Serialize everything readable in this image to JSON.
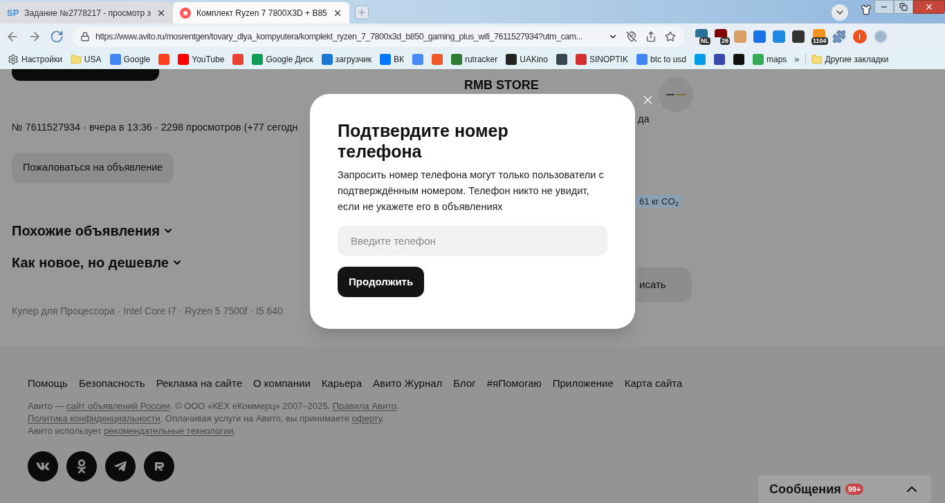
{
  "browser": {
    "tabs": [
      {
        "favicon_text": "SP",
        "title": "Задание №2778217 - просмотр з",
        "selected": false
      },
      {
        "title": "Комплект Ryzen 7 7800X3D + B85",
        "selected": true
      }
    ],
    "url": "https://www.avito.ru/mosrentgen/tovary_dlya_kompyutera/komplekt_ryzen_7_7800x3d_b850_gaming_plus_wifi_7611527934?utm_cam...",
    "extensions": [
      {
        "color": "#2a6f97",
        "badge": "NL"
      },
      {
        "color": "#800000",
        "badge": "26"
      },
      {
        "color": "#d9a066"
      },
      {
        "color": "#1a73e8"
      },
      {
        "color": "#1e88e5"
      },
      {
        "color": "#333333"
      },
      {
        "color": "#f7931a",
        "badge": "1104"
      }
    ],
    "profile_initial": "I",
    "bookmarks": [
      {
        "kind": "gear",
        "label": "Настройки"
      },
      {
        "kind": "folder",
        "label": "USA"
      },
      {
        "kind": "favicon",
        "color": "#4285f4",
        "label": "Google"
      },
      {
        "kind": "favicon",
        "color": "#fc3f1d"
      },
      {
        "kind": "favicon",
        "color": "#ff0000",
        "label": "YouTube"
      },
      {
        "kind": "favicon",
        "color": "#ea4335"
      },
      {
        "kind": "favicon",
        "color": "#0f9d58",
        "label": "Google Диск"
      },
      {
        "kind": "favicon",
        "color": "#1976d2",
        "label": "загрузчик"
      },
      {
        "kind": "favicon",
        "color": "#0077ff",
        "label": "ВК"
      },
      {
        "kind": "favicon",
        "color": "#4a8af4"
      },
      {
        "kind": "favicon",
        "color": "#f05a28"
      },
      {
        "kind": "favicon",
        "color": "#2e7d32",
        "label": "rutracker"
      },
      {
        "kind": "favicon",
        "color": "#222222",
        "label": "UAKino"
      },
      {
        "kind": "favicon",
        "color": "#37474f"
      },
      {
        "kind": "favicon",
        "color": "#d32f2f",
        "label": "SINOPTIK"
      },
      {
        "kind": "favicon",
        "color": "#4285f4",
        "label": "btc to usd"
      },
      {
        "kind": "favicon",
        "color": "#039be5"
      },
      {
        "kind": "favicon",
        "color": "#3949ab"
      },
      {
        "kind": "favicon",
        "color": "#111111"
      },
      {
        "kind": "favicon",
        "color": "#34a853",
        "label": "maps"
      }
    ],
    "overflow": "»",
    "other_bookmarks": "Другие закладки"
  },
  "page": {
    "meta": "№ 7611527934 · вчера в 13:36 · 2298 просмотров (+77 сегодн",
    "complaint_button": "Пожаловаться на объявление",
    "sections": [
      {
        "title": "Похожие объявления",
        "expanded": false
      },
      {
        "title": "Как новое, но дешевле",
        "expanded": false
      }
    ],
    "related_searches": "Кулер для Процессора · Intel Core I7 · Ryzen 5 7500f · I5 640",
    "seller": {
      "name": "RMB STORE",
      "fragment": "да",
      "eco_badge": "61 кг CO$_{2}$",
      "button_fragment": "исать"
    }
  },
  "modal": {
    "title": "Подтвердите номер телефона",
    "text": "Запросить номер телефона могут только пользователи с подтверждённым номером. Телефон никто не увидит, если не укажете его в объявлениях",
    "phone_field": {
      "placeholder": "Введите телефон"
    },
    "submit": "Продолжить"
  },
  "footer": {
    "links": [
      "Помощь",
      "Безопасность",
      "Реклама на сайте",
      "О компании",
      "Карьера",
      "Авито Журнал",
      "Блог",
      "#яПомогаю",
      "Приложение",
      "Карта сайта"
    ],
    "legal": [
      [
        {
          "text": "Авито — "
        },
        {
          "text": "сайт объявлений России",
          "link": true
        },
        {
          "text": ". © ООО «КЕХ еКоммерц» 2007–2025. "
        },
        {
          "text": "Правила Авито",
          "link": true
        },
        {
          "text": "."
        }
      ],
      [
        {
          "text": "Политика конфиденциальности",
          "link": true
        },
        {
          "text": ". Оплачивая услуги на Авито, вы принимаете "
        },
        {
          "text": "оферту",
          "link": true
        },
        {
          "text": "."
        }
      ],
      [
        {
          "text": "Авито использует "
        },
        {
          "text": "рекомендательные технологии",
          "link": true
        },
        {
          "text": "."
        }
      ]
    ],
    "socials": [
      {
        "kind": "vk"
      },
      {
        "kind": "ok"
      },
      {
        "kind": "telegram"
      },
      {
        "kind": "rutube"
      }
    ]
  },
  "messages": {
    "label": "Сообщения",
    "badge": "99+"
  }
}
